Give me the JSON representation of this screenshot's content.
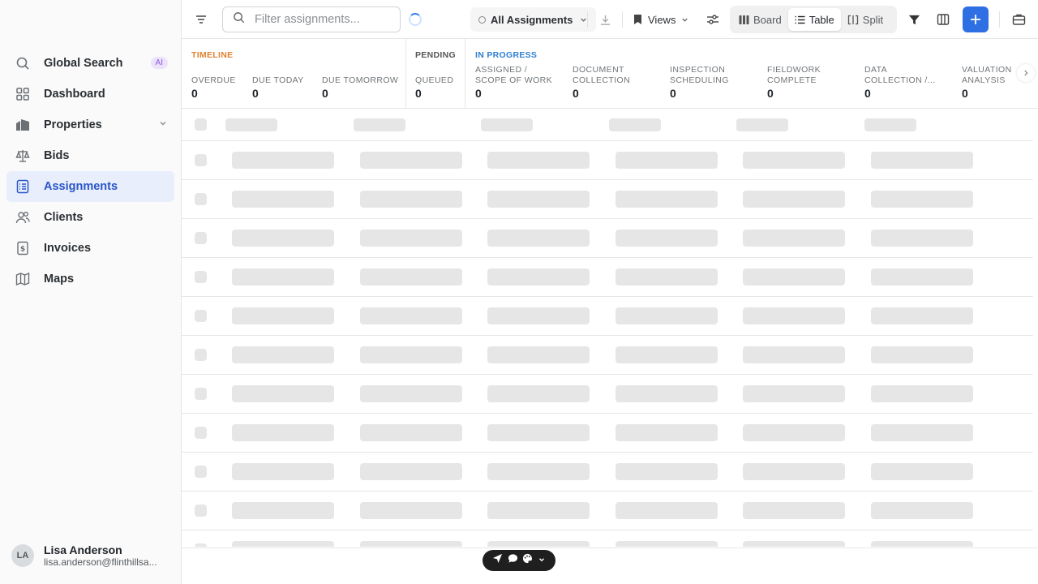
{
  "sidebar": {
    "items": [
      {
        "label": "Global Search",
        "icon": "search-icon",
        "badge": "AI"
      },
      {
        "label": "Dashboard",
        "icon": "dashboard-icon"
      },
      {
        "label": "Properties",
        "icon": "building-icon"
      },
      {
        "label": "Bids",
        "icon": "scale-icon"
      },
      {
        "label": "Assignments",
        "icon": "clipboard-list-icon",
        "active": true
      },
      {
        "label": "Clients",
        "icon": "users-icon"
      },
      {
        "label": "Invoices",
        "icon": "invoice-icon"
      },
      {
        "label": "Maps",
        "icon": "map-icon"
      }
    ],
    "user": {
      "initials": "LA",
      "name": "Lisa Anderson",
      "email": "lisa.anderson@flinthillsa..."
    }
  },
  "toolbar": {
    "search_placeholder": "Filter assignments...",
    "filter_select": "All Assignments",
    "views_label": "Views",
    "board_label": "Board",
    "table_label": "Table",
    "split_label": "Split",
    "active_view": "Table"
  },
  "status": {
    "timeline": {
      "label": "TIMELINE",
      "color": "#e0822e",
      "cols": [
        {
          "label": "OVERDUE",
          "count": "0"
        },
        {
          "label": "DUE TODAY",
          "count": "0"
        },
        {
          "label": "DUE TOMORROW",
          "count": "0"
        }
      ]
    },
    "pending": {
      "label": "PENDING",
      "cols": [
        {
          "label": "QUEUED",
          "count": "0"
        }
      ]
    },
    "in_progress": {
      "label": "IN PROGRESS",
      "color": "#2f7fd1",
      "cols": [
        {
          "line1": "ASSIGNED /",
          "line2": "SCOPE OF WORK",
          "count": "0"
        },
        {
          "line1": "DOCUMENT",
          "line2": "COLLECTION",
          "count": "0"
        },
        {
          "line1": "INSPECTION",
          "line2": "SCHEDULING",
          "count": "0"
        },
        {
          "line1": "FIELDWORK",
          "line2": "COMPLETE",
          "count": "0"
        },
        {
          "line1": "DATA",
          "line2": "COLLECTION /...",
          "count": "0"
        },
        {
          "line1": "VALUATION",
          "line2": "ANALYSIS",
          "count": "0"
        }
      ]
    }
  },
  "colors": {
    "accent": "#2f6fe4",
    "active_nav_bg": "#e8eefb",
    "skeleton": "#e6e6e6"
  }
}
